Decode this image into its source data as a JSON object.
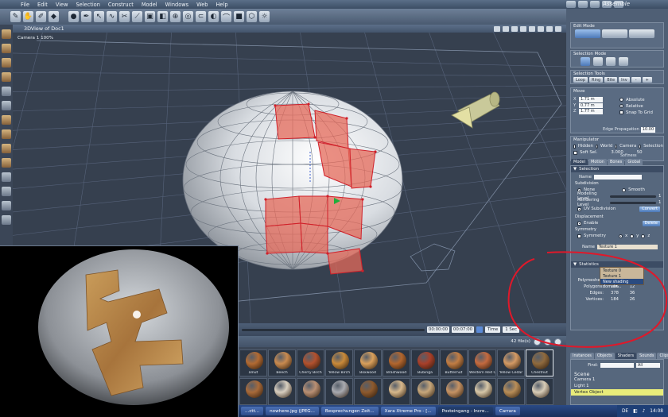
{
  "menubar": {
    "items": [
      "File",
      "Edit",
      "View",
      "Selection",
      "Construct",
      "Model",
      "Windows",
      "Web",
      "Help"
    ],
    "room_title": "Assemble"
  },
  "view": {
    "title": "3DView of Doc1",
    "camera_label": "Camera 1 100%"
  },
  "timeline": {
    "time_start": "00:00:00",
    "time_end": "00:07:00",
    "time_select": "Time",
    "scale_select": "1 Sec"
  },
  "browser": {
    "file_count": "42 file(s)",
    "swatches_row1": [
      {
        "label": "alnut",
        "color": "#b26a32"
      },
      {
        "label": "Beech",
        "color": "#c98a4f"
      },
      {
        "label": "Cherry Birch",
        "color": "#b2512e"
      },
      {
        "label": "Yellow Birch",
        "color": "#c98a3a"
      },
      {
        "label": "Boxwood",
        "color": "#d9a05c"
      },
      {
        "label": "Brashwood",
        "color": "#b2662e"
      },
      {
        "label": "Bubinga",
        "color": "#a9402a"
      },
      {
        "label": "Butternut",
        "color": "#c17d44"
      },
      {
        "label": "Western Red C",
        "color": "#c46a3f"
      },
      {
        "label": "Yellow Cedar",
        "color": "#d49a64"
      },
      {
        "label": "Chestnut",
        "color": "#8f6a3e"
      }
    ],
    "swatches_row2_colors": [
      "#a86a3a",
      "#d8cfc0",
      "#b99074",
      "#a9aab0",
      "#8d5a2e",
      "#d7b88c",
      "#c7a77b",
      "#c69364",
      "#d7c7a8",
      "#b98e58",
      "#d9cdb8"
    ]
  },
  "taskbar": {
    "tasks": [
      "...ctt...",
      "nowhere.jpg (JPEG...",
      "Besprechungen Zeit...",
      "Xara Xtreme Pro - [...",
      "Posteingang - Incre...",
      "Carrara"
    ],
    "tray_lang": "DE",
    "clock": "14:08"
  },
  "panel": {
    "edit_mode_title": "Edit Mode",
    "selection_mode_title": "Selection Mode",
    "selection_tools_title": "Selection Tools",
    "sel_tools": [
      "Loop",
      "Ring",
      "Bite",
      "Inv",
      "-",
      "+"
    ],
    "move_title": "Move",
    "move": {
      "x": "1.71 m",
      "y": "0.77 m",
      "z": "1.77 m"
    },
    "move_opts": [
      "Absolute",
      "Relative",
      "Snap To Grid"
    ],
    "edge_propagation_label": "Edge Propagation",
    "edge_propagation_value": "10.00",
    "manipulator_title": "Manipulator",
    "manipulator_opts": [
      "Hidden",
      "World",
      "Camera",
      "Selection"
    ],
    "soft_sel_label": "Soft Sel.",
    "soft_sel_value": "3.000",
    "softness_label": "Softness",
    "softness_value": "50",
    "tabs": [
      "Model",
      "Motion",
      "Bones",
      "Global"
    ],
    "selection_head": "Selection",
    "name_label": "Name",
    "subdivision_label": "Subdivision",
    "subdiv_opts": [
      "None",
      "Smooth"
    ],
    "modeling_level_label": "Modeling Level",
    "rendering_level_label": "Rendering Level",
    "level_value": "1",
    "uv_subdivision_label": "UV Subdivision",
    "convert_btn": "Convert",
    "displacement_label": "Displacement",
    "enable_label": "Enable",
    "delete_btn": "Delete",
    "symmetry_label": "Symmetry",
    "symmetry_opts": [
      "x",
      "y",
      "z"
    ],
    "shading_name_label": "Name",
    "shading_value": "Texture 1",
    "dropdown": [
      "Texture 0",
      "Texture 1",
      "New shading domain..."
    ],
    "statistics_head": "Statistics",
    "stats": [
      {
        "label": "Polymeshes:",
        "a": "1",
        "b": "0"
      },
      {
        "label": "Polygons:",
        "a": "196",
        "b": "12"
      },
      {
        "label": "Edges:",
        "a": "378",
        "b": "36"
      },
      {
        "label": "Vertices:",
        "a": "184",
        "b": "26"
      }
    ],
    "instance_tabs": [
      "Instances",
      "Objects",
      "Shaders",
      "Sounds",
      "Clips"
    ],
    "find_label": "Find:",
    "find_select": "All",
    "scene_items": [
      "Scene",
      "Camera 1",
      "Light 1",
      "Vertex Object"
    ]
  },
  "colors": {
    "accent": "#4b78b8",
    "annotation": "#e0182a",
    "selected_poly": "#e0554a"
  }
}
